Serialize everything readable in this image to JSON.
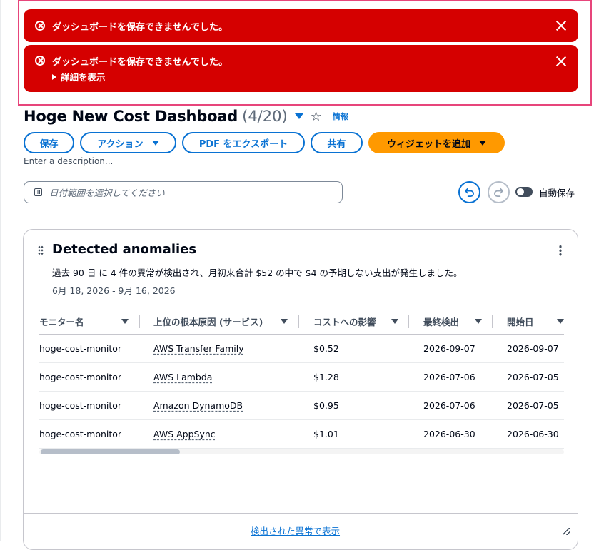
{
  "flashes": [
    {
      "message": "ダッシュボードを保存できませんでした。"
    },
    {
      "message": "ダッシュボードを保存できませんでした。",
      "details_label": "詳細を表示"
    }
  ],
  "header": {
    "title": "Hoge New Cost Dashboad",
    "count": "(4/20)",
    "info": "情報"
  },
  "toolbar": {
    "save": "保存",
    "actions": "アクション",
    "export_pdf": "PDF をエクスポート",
    "share": "共有",
    "add_widget": "ウィジェットを追加"
  },
  "description_placeholder": "Enter a description...",
  "date_range": {
    "placeholder": "日付範囲を選択してください"
  },
  "autosave_label": "自動保存",
  "widget": {
    "title": "Detected anomalies",
    "description": "過去 90 日 に 4 件の異常が検出され、月初来合計 $52 の中で $4 の予期しない支出が発生しました。",
    "range": "6月 18, 2026 - 9月 16, 2026",
    "columns": [
      "モニター名",
      "上位の根本原因 (サービス)",
      "コストへの影響",
      "最終検出",
      "開始日"
    ],
    "rows": [
      {
        "monitor": "hoge-cost-monitor",
        "service": "AWS Transfer Family",
        "impact": "$0.52",
        "last": "2026-09-07",
        "start": "2026-09-07"
      },
      {
        "monitor": "hoge-cost-monitor",
        "service": "AWS Lambda",
        "impact": "$1.28",
        "last": "2026-07-06",
        "start": "2026-07-05"
      },
      {
        "monitor": "hoge-cost-monitor",
        "service": "Amazon DynamoDB",
        "impact": "$0.95",
        "last": "2026-07-06",
        "start": "2026-07-05"
      },
      {
        "monitor": "hoge-cost-monitor",
        "service": "AWS AppSync",
        "impact": "$1.01",
        "last": "2026-06-30",
        "start": "2026-06-30"
      }
    ],
    "footer_link": "検出された異常で表示"
  },
  "colors": {
    "error": "#d50000",
    "primary": "#0972d3",
    "accent": "#ff9900",
    "highlight_frame": "#e7457b"
  }
}
